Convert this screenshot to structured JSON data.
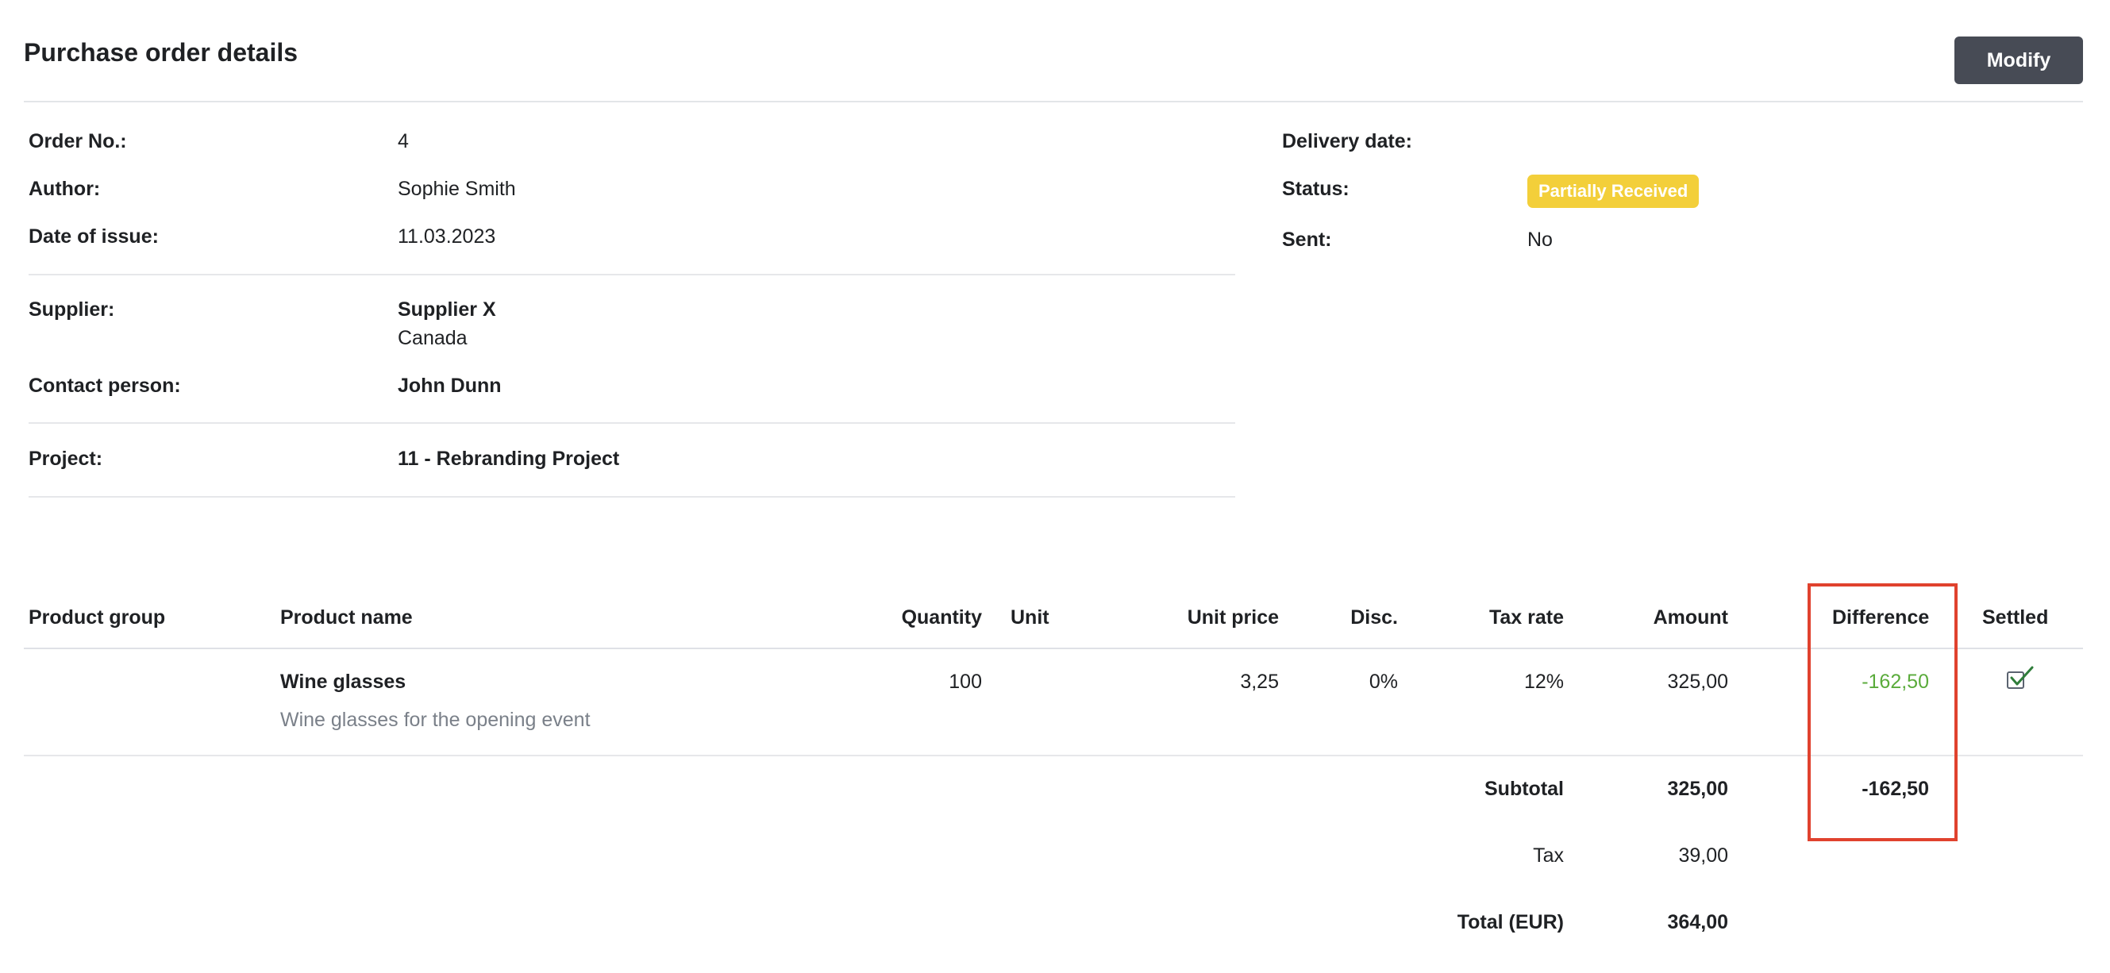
{
  "header": {
    "title": "Purchase order details",
    "modify_label": "Modify"
  },
  "details_left": {
    "order_no_label": "Order No.:",
    "order_no": "4",
    "author_label": "Author:",
    "author": "Sophie Smith",
    "date_label": "Date of issue:",
    "date": "11.03.2023",
    "supplier_label": "Supplier:",
    "supplier_name": "Supplier X",
    "supplier_country": "Canada",
    "contact_label": "Contact person:",
    "contact": "John Dunn",
    "project_label": "Project:",
    "project": "11 - Rebranding Project"
  },
  "details_right": {
    "delivery_label": "Delivery date:",
    "delivery": "",
    "status_label": "Status:",
    "status": "Partially Received",
    "status_color": "#f3cf3a",
    "sent_label": "Sent:",
    "sent": "No"
  },
  "table": {
    "columns": [
      "Product group",
      "Product name",
      "Quantity",
      "Unit",
      "Unit price",
      "Disc.",
      "Tax rate",
      "Amount",
      "Difference",
      "Settled"
    ],
    "rows": [
      {
        "product_group": "",
        "product_name": "Wine glasses",
        "description": "Wine glasses for the opening event",
        "quantity": "100",
        "unit": "",
        "unit_price": "3,25",
        "discount": "0%",
        "tax_rate": "12%",
        "amount": "325,00",
        "difference": "-162,50",
        "settled": true
      }
    ],
    "difference_color": "#5aab3b"
  },
  "totals": {
    "subtotal_label": "Subtotal",
    "subtotal": "325,00",
    "subtotal_difference": "-162,50",
    "tax_label": "Tax",
    "tax": "39,00",
    "total_label": "Total (EUR)",
    "total": "364,00"
  },
  "highlight_color": "#e0422e"
}
